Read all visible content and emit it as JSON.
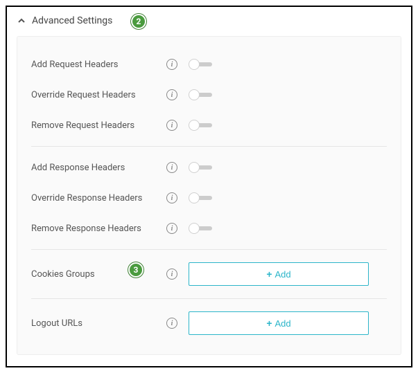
{
  "section": {
    "title": "Advanced Settings"
  },
  "callouts": {
    "c2": "2",
    "c3": "3"
  },
  "groups": {
    "request": [
      {
        "label": "Add Request Headers"
      },
      {
        "label": "Override Request Headers"
      },
      {
        "label": "Remove Request Headers"
      }
    ],
    "response": [
      {
        "label": "Add Response Headers"
      },
      {
        "label": "Override Response Headers"
      },
      {
        "label": "Remove Response Headers"
      }
    ]
  },
  "actions": {
    "cookies_groups_label": "Cookies Groups",
    "logout_urls_label": "Logout URLs",
    "add_label": "Add"
  }
}
